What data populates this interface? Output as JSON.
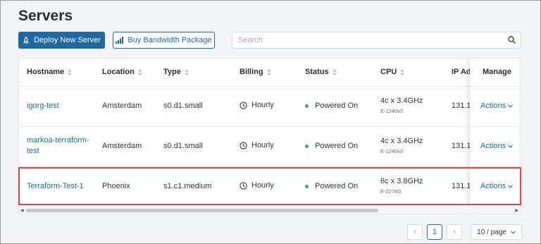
{
  "page": {
    "title": "Servers"
  },
  "toolbar": {
    "deploy_label": "Deploy New Server",
    "bandwidth_label": "Buy Bandwidth Package",
    "search_placeholder": "Search"
  },
  "table": {
    "columns": [
      "Hostname",
      "Location",
      "Type",
      "Billing",
      "Status",
      "CPU",
      "IP Ad",
      "Manage"
    ],
    "rows": [
      {
        "hostname": "igorg-test",
        "hostname_line2": "",
        "location": "Amsterdam",
        "type": "s0.d1.small",
        "billing": "Hourly",
        "status": "Powered On",
        "cpu": "4c x 3.4GHz",
        "cpu_model": "E-1240v3",
        "ip": "131.1",
        "manage": "Actions"
      },
      {
        "hostname": "markoa-terraform-",
        "hostname_line2": "test",
        "location": "Amsterdam",
        "type": "s0.d1.small",
        "billing": "Hourly",
        "status": "Powered On",
        "cpu": "4c x 3.4GHz",
        "cpu_model": "E-1240v3",
        "ip": "131.1",
        "manage": "Actions"
      },
      {
        "hostname": "Terraform-Test-1",
        "hostname_line2": "",
        "location": "Phoenix",
        "type": "s1.c1.medium",
        "billing": "Hourly",
        "status": "Powered On",
        "cpu": "6c x 3.8GHz",
        "cpu_model": "E-2276G",
        "ip": "131.1",
        "manage": "Actions"
      }
    ]
  },
  "pagination": {
    "current_page": "1",
    "prev": "‹",
    "next": "›",
    "per_page": "10 / page"
  },
  "colors": {
    "primary": "#1f68a3",
    "status_on": "#3bb34a",
    "highlight": "#e0444a"
  },
  "icons": [
    "rocket-icon",
    "bar-chart-icon",
    "search-icon",
    "sort-icon",
    "clock-icon",
    "chevron-down-icon"
  ]
}
